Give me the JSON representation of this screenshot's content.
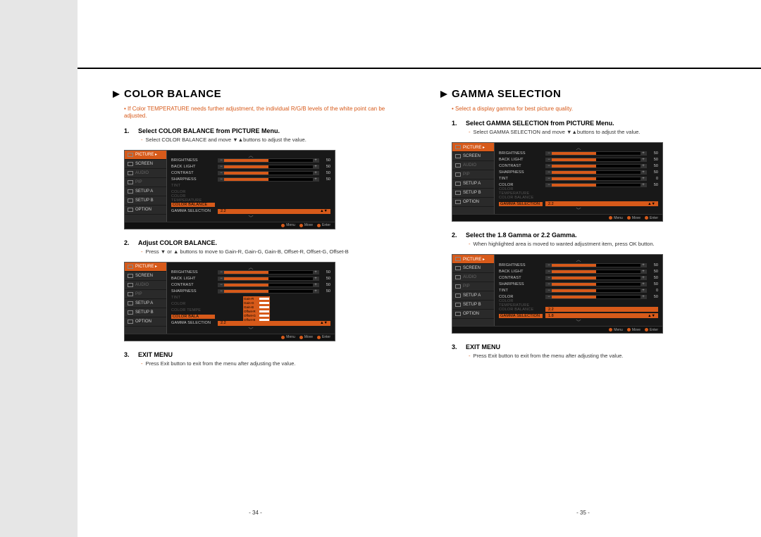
{
  "left": {
    "title": "COLOR BALANCE",
    "note": "If Color TEMPERATURE needs further adjustment, the individual R/G/B levels of the white point can be adjusted.",
    "steps": [
      {
        "num": "1.",
        "head": "Select COLOR BALANCE from PICTURE Menu.",
        "sub": "Select COLOR BALANCE and move ▼▲buttons to adjust the value."
      },
      {
        "num": "2.",
        "head": "Adjust COLOR BALANCE.",
        "sub": "Press ▼ or ▲ buttons to move to Gain-R, Gain-G, Gain-B, Offset-R, Offset-G, Offset-B"
      },
      {
        "num": "3.",
        "head": "EXIT MENU",
        "sub": "Press Exit button to exit from the menu after adjusting the value."
      }
    ],
    "osd": {
      "side": [
        "PICTURE ▸",
        "SCREEN",
        "AUDIO",
        "PIP",
        "SETUP A",
        "SETUP B",
        "OPTION"
      ],
      "sliders": [
        {
          "label": "BRIGHTNESS",
          "value": "50",
          "pct": 50
        },
        {
          "label": "BACK LIGHT",
          "value": "50",
          "pct": 50
        },
        {
          "label": "CONTRAST",
          "value": "50",
          "pct": 50
        },
        {
          "label": "SHARPNESS",
          "value": "50",
          "pct": 50
        }
      ],
      "muted": [
        "TINT",
        "COLOR",
        "COLOR TEMPERATURE"
      ],
      "highlight_label": "COLOR BALANCE",
      "select": {
        "label": "GAMMA SELECTION",
        "value": "2.2"
      },
      "foot": [
        "Menu",
        "Move",
        "Enter"
      ]
    },
    "osd2_popup": [
      "Gain-R",
      "Gain-G",
      "Gain-B",
      "Offset-R",
      "Offset-G",
      "Offset-B"
    ],
    "osd2_highlight_label": "COLOR BALA",
    "osd2_color_temp_label": "COLOR TEMPE",
    "page": "- 34 -"
  },
  "right": {
    "title": "GAMMA SELECTION",
    "note": "Select a display gamma for best picture quality.",
    "steps": [
      {
        "num": "1.",
        "head": "Select GAMMA SELECTION from PICTURE Menu.",
        "sub": "Select GAMMA SELECTION and move ▼▲buttons to adjust the value."
      },
      {
        "num": "2.",
        "head": "Select the 1.8 Gamma or 2.2 Gamma.",
        "sub": "When highlighted area is moved to wanted adjustment item, press OK button."
      },
      {
        "num": "3.",
        "head": "EXIT MENU",
        "sub": "Press Exit button to exit from the menu after adjusting the value."
      }
    ],
    "osd": {
      "side": [
        "PICTURE ▸",
        "SCREEN",
        "AUDIO",
        "PIP",
        "SETUP A",
        "SETUP B",
        "OPTION"
      ],
      "sliders": [
        {
          "label": "BRIGHTNESS",
          "value": "50",
          "pct": 50
        },
        {
          "label": "BACK LIGHT",
          "value": "50",
          "pct": 50
        },
        {
          "label": "CONTRAST",
          "value": "50",
          "pct": 50
        },
        {
          "label": "SHARPNESS",
          "value": "50",
          "pct": 50
        },
        {
          "label": "TINT",
          "value": "0",
          "pct": 50
        },
        {
          "label": "COLOR",
          "value": "50",
          "pct": 50
        }
      ],
      "muted": [
        "COLOR TEMPERATURE",
        "COLOR BALANCE"
      ],
      "select": {
        "label": "GAMMA SELECTION",
        "value": "2.2"
      },
      "foot": [
        "Menu",
        "Move",
        "Enter"
      ]
    },
    "osd2_select_value": "1.8",
    "osd2_gamma_label": "GAMMA SELECTION",
    "osd2_color_balance_row": {
      "label": "COLOR BALANCE",
      "value": "2.2"
    },
    "page": "- 35 -"
  }
}
